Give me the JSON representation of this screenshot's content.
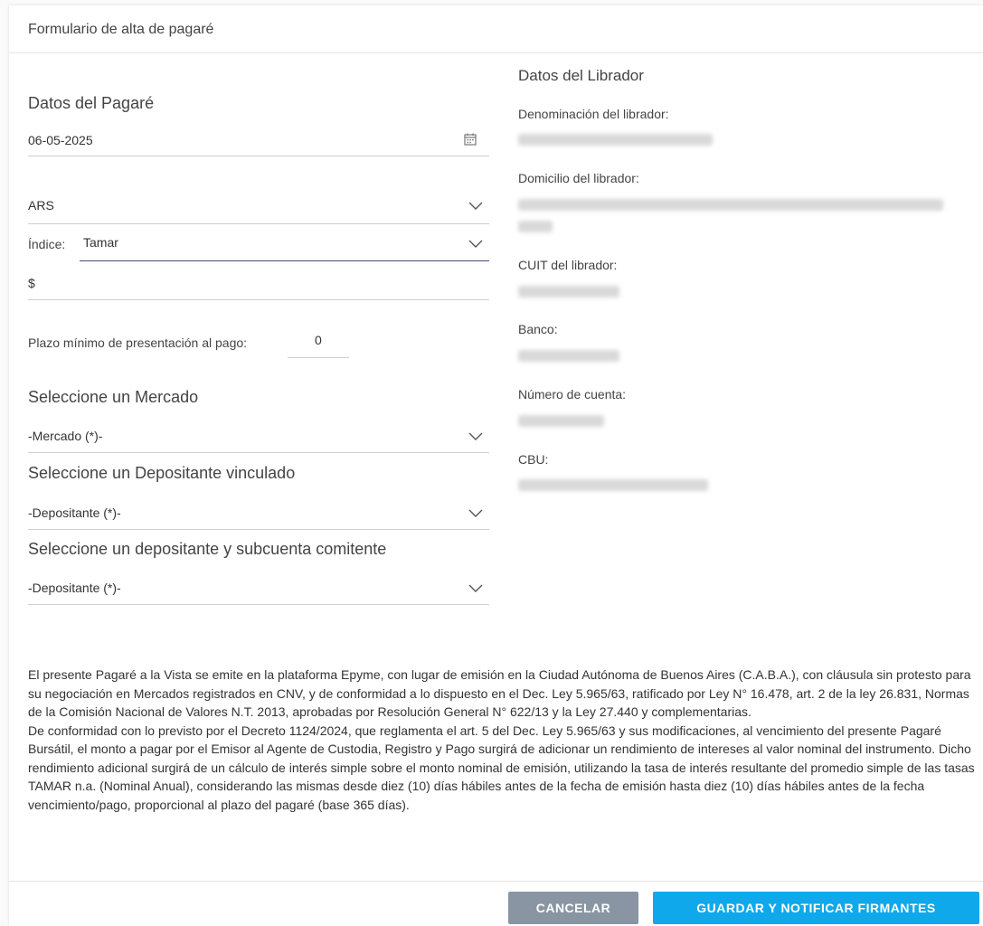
{
  "header": {
    "title": "Formulario de alta de pagaré"
  },
  "pagare": {
    "section_title": "Datos del Pagaré",
    "date_value": "06-05-2025",
    "currency_value": "ARS",
    "index_label": "Índice:",
    "index_value": "Tamar",
    "amount_prefix": "$",
    "plazo_label": "Plazo mínimo de presentación al pago:",
    "plazo_value": "0"
  },
  "mercado": {
    "section_title": "Seleccione un Mercado",
    "placeholder": "-Mercado (*)-"
  },
  "depositante_vinculado": {
    "section_title": "Seleccione un Depositante vinculado",
    "placeholder": "-Depositante (*)-"
  },
  "depositante_subcuenta": {
    "section_title": "Seleccione un depositante y subcuenta comitente",
    "placeholder": "-Depositante (*)-"
  },
  "librador": {
    "section_title": "Datos del Librador",
    "denominacion_label": "Denominación del librador:",
    "domicilio_label": "Domicilio del librador:",
    "cuit_label": "CUIT del librador:",
    "banco_label": "Banco:",
    "cuenta_label": "Número de cuenta:",
    "cbu_label": "CBU:"
  },
  "legal": {
    "paragraph1": "El presente Pagaré a la Vista se emite en la plataforma Epyme, con lugar de emisión en la Ciudad Autónoma de Buenos Aires (C.A.B.A.), con cláusula sin protesto para su negociación en Mercados registrados en CNV, y de conformidad a lo dispuesto en el Dec. Ley 5.965/63, ratificado por Ley N° 16.478, art. 2 de la ley 26.831, Normas de la Comisión Nacional de Valores N.T. 2013, aprobadas por Resolución General N° 622/13 y la Ley 27.440 y complementarias.",
    "paragraph2": "De conformidad con lo previsto por el Decreto 1124/2024, que reglamenta el art. 5 del Dec. Ley 5.965/63 y sus modificaciones, al vencimiento del presente Pagaré Bursátil, el monto a pagar por el Emisor al Agente de Custodia, Registro y Pago surgirá de adicionar un rendimiento de intereses al valor nominal del instrumento. Dicho rendimiento adicional surgirá de un cálculo de interés simple sobre el monto nominal de emisión, utilizando la tasa de interés resultante del promedio simple de las tasas TAMAR n.a. (Nominal Anual), considerando las mismas desde diez (10) días hábiles antes de la fecha de emisión hasta diez (10) días hábiles antes de la fecha vencimiento/pago, proporcional al plazo del pagaré (base 365 días)."
  },
  "buttons": {
    "cancel": "CANCELAR",
    "save": "GUARDAR Y NOTIFICAR FIRMANTES"
  },
  "colors": {
    "primary": "#0fa8eb",
    "cancel": "#8a95a3",
    "index_underline": "#3f4a7a"
  },
  "icons": {
    "calendar": "calendar-icon",
    "chevron": "chevron-down-icon"
  }
}
